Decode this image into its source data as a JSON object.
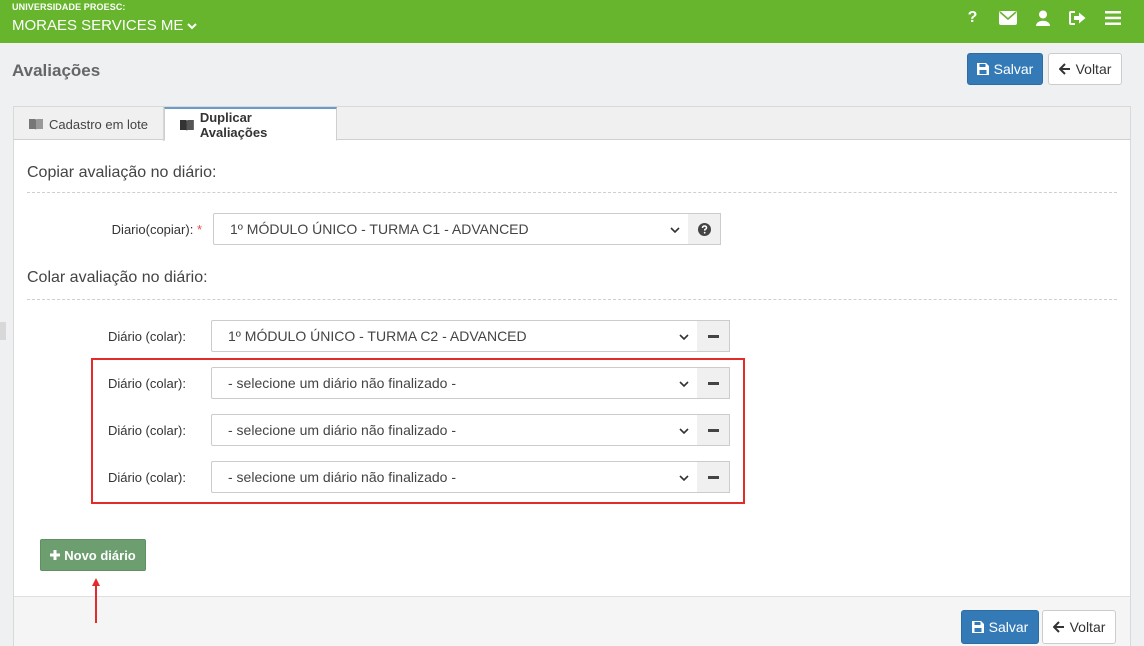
{
  "header": {
    "university": "UNIVERSIDADE PROESC:",
    "company": "MORAES SERVICES ME",
    "icons": [
      "help-icon",
      "envelope-icon",
      "user-icon",
      "sign-out-icon",
      "menu-icon"
    ],
    "help_glyph": "?"
  },
  "page": {
    "title": "Avaliações",
    "save_label": "Salvar",
    "back_label": "Voltar"
  },
  "tabs": [
    {
      "label": "Cadastro em lote",
      "active": false
    },
    {
      "label": "Duplicar Avaliações",
      "active": true
    }
  ],
  "copy_section": {
    "title": "Copiar avaliação no diário:",
    "label": "Diario(copiar):",
    "required_mark": "*",
    "selected": "1º MÓDULO ÚNICO - TURMA C1 - ADVANCED"
  },
  "paste_section": {
    "title": "Colar avaliação no diário:",
    "rows": [
      {
        "label": "Diário (colar):",
        "selected": "1º MÓDULO ÚNICO - TURMA C2 - ADVANCED"
      },
      {
        "label": "Diário (colar):",
        "selected": "- selecione um diário não finalizado -"
      },
      {
        "label": "Diário (colar):",
        "selected": "- selecione um diário não finalizado -"
      },
      {
        "label": "Diário (colar):",
        "selected": "- selecione um diário não finalizado -"
      }
    ]
  },
  "actions": {
    "new_diary_label": "Novo diário",
    "save_label": "Salvar",
    "back_label": "Voltar"
  },
  "colors": {
    "topbar": "#66b52d",
    "primary": "#337ab7",
    "success": "#6c9e6f",
    "highlight": "#e32b2b"
  }
}
